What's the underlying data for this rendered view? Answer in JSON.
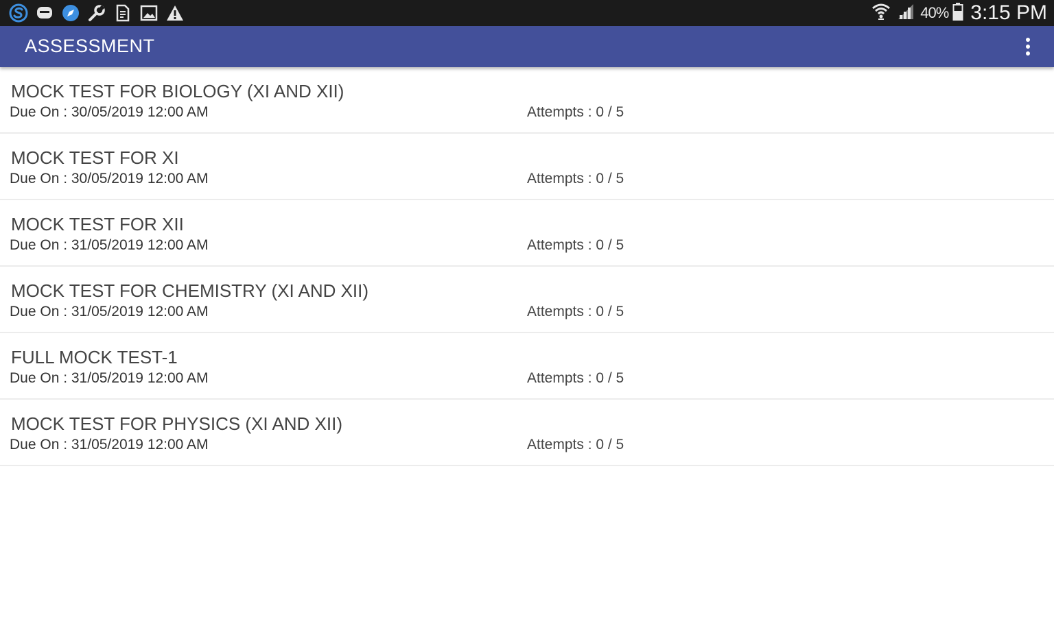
{
  "status_bar": {
    "left_icons": [
      "skype-icon",
      "chat-bubble-icon",
      "browser-compass-icon",
      "wrench-icon",
      "document-icon",
      "image-icon",
      "warning-icon"
    ],
    "right_icons": [
      "wifi-icon",
      "signal-icon",
      "battery-icon"
    ],
    "battery": "40%",
    "time": "3:15 PM"
  },
  "app_bar": {
    "title": "ASSESSMENT",
    "menu_icon": "more-vertical-icon"
  },
  "colors": {
    "status_bar": "#1b1b1b",
    "app_bar": "#43509a",
    "background": "#ffffff",
    "divider": "#ececec"
  },
  "assessments": [
    {
      "title": "MOCK TEST FOR BIOLOGY (XI AND XII)",
      "due": "Due On : 30/05/2019 12:00 AM",
      "attempts": "Attempts : 0 / 5"
    },
    {
      "title": "MOCK TEST FOR XI",
      "due": "Due On : 30/05/2019 12:00 AM",
      "attempts": "Attempts : 0 / 5"
    },
    {
      "title": "MOCK TEST FOR XII",
      "due": "Due On : 31/05/2019 12:00 AM",
      "attempts": "Attempts : 0 / 5"
    },
    {
      "title": "MOCK TEST FOR CHEMISTRY (XI AND XII)",
      "due": "Due On : 31/05/2019 12:00 AM",
      "attempts": "Attempts : 0 / 5"
    },
    {
      "title": "FULL MOCK TEST-1",
      "due": "Due On : 31/05/2019 12:00 AM",
      "attempts": "Attempts : 0 / 5"
    },
    {
      "title": "MOCK TEST FOR PHYSICS (XI AND XII)",
      "due": "Due On : 31/05/2019 12:00 AM",
      "attempts": "Attempts : 0 / 5"
    }
  ]
}
